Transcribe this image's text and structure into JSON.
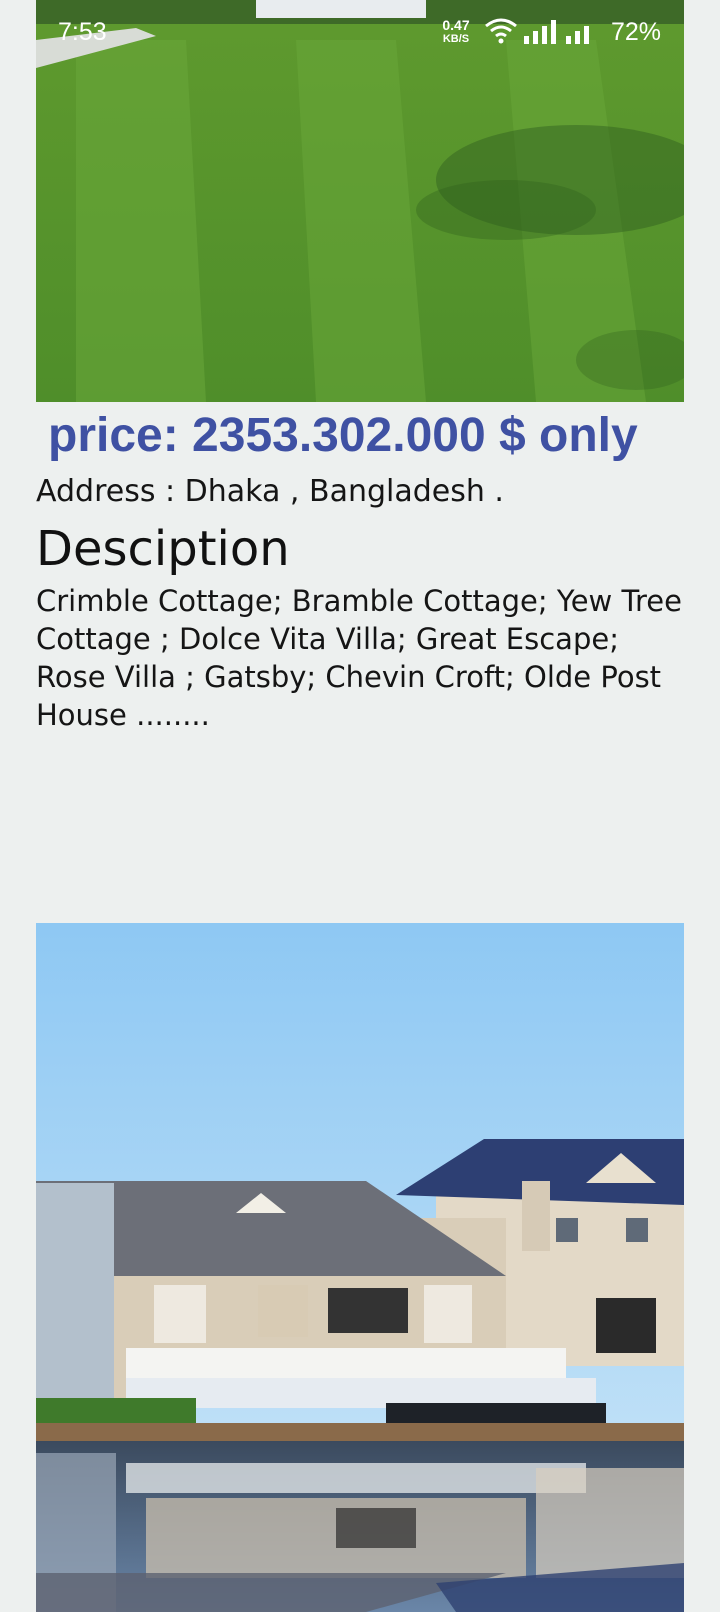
{
  "status_bar": {
    "time": "7:53",
    "net_speed_value": "0.47",
    "net_speed_unit": "KB/S",
    "battery": "72%",
    "icons": [
      "wifi-icon",
      "signal-icon",
      "signal-icon-secondary"
    ]
  },
  "listing": {
    "price": "price: 2353.302.000 $ only",
    "address": "Address : Dhaka , Bangladesh .",
    "description_heading": "Desciption",
    "description": "Crimble Cottage; Bramble Cottage; Yew Tree Cottage ; Dolce Vita Villa; Great Escape; Rose Villa ; Gatsby; Chevin Croft; Olde Post House ........"
  },
  "colors": {
    "price": "#3f51a3",
    "background": "#edf0ef"
  }
}
